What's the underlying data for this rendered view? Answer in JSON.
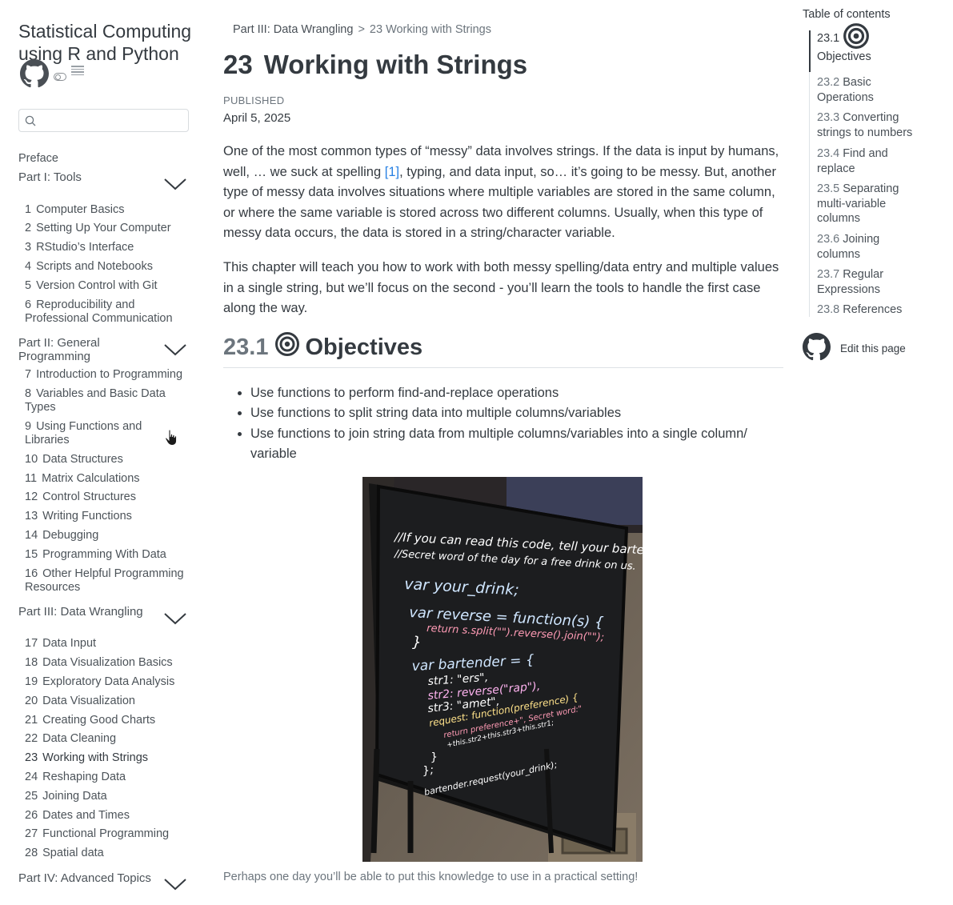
{
  "site": {
    "title": "Statistical Computing using R and Python",
    "search_placeholder": ""
  },
  "sidebar": {
    "preface": "Preface",
    "parts": [
      {
        "label": "Part I: Tools",
        "expanded": true
      },
      {
        "label": "Part II: General Programming",
        "expanded": true
      },
      {
        "label": "Part III: Data Wrangling",
        "expanded": true
      },
      {
        "label": "Part IV: Advanced Topics",
        "expanded": false
      }
    ],
    "chapters": [
      {
        "num": "1",
        "title": "Computer Basics"
      },
      {
        "num": "2",
        "title": "Setting Up Your Computer"
      },
      {
        "num": "3",
        "title": "RStudio’s Interface"
      },
      {
        "num": "4",
        "title": "Scripts and Notebooks"
      },
      {
        "num": "5",
        "title": "Version Control with Git"
      },
      {
        "num": "6",
        "title": "Reproducibility and Professional Communication"
      },
      {
        "num": "7",
        "title": "Introduction to Programming"
      },
      {
        "num": "8",
        "title": "Variables and Basic Data Types"
      },
      {
        "num": "9",
        "title": "Using Functions and Libraries"
      },
      {
        "num": "10",
        "title": "Data Structures"
      },
      {
        "num": "11",
        "title": "Matrix Calculations"
      },
      {
        "num": "12",
        "title": "Control Structures"
      },
      {
        "num": "13",
        "title": "Writing Functions"
      },
      {
        "num": "14",
        "title": "Debugging"
      },
      {
        "num": "15",
        "title": "Programming With Data"
      },
      {
        "num": "16",
        "title": "Other Helpful Programming Resources"
      },
      {
        "num": "17",
        "title": "Data Input"
      },
      {
        "num": "18",
        "title": "Data Visualization Basics"
      },
      {
        "num": "19",
        "title": "Exploratory Data Analysis"
      },
      {
        "num": "20",
        "title": "Data Visualization"
      },
      {
        "num": "21",
        "title": "Creating Good Charts"
      },
      {
        "num": "22",
        "title": "Data Cleaning"
      },
      {
        "num": "23",
        "title": "Working with Strings"
      },
      {
        "num": "24",
        "title": "Reshaping Data"
      },
      {
        "num": "25",
        "title": "Joining Data"
      },
      {
        "num": "26",
        "title": "Dates and Times"
      },
      {
        "num": "27",
        "title": "Functional Programming"
      },
      {
        "num": "28",
        "title": "Spatial data"
      }
    ]
  },
  "breadcrumb": {
    "part": "Part III: Data Wrangling",
    "separator": ">",
    "current": "23  Working with Strings"
  },
  "chapter": {
    "num": "23",
    "title": "Working with Strings",
    "published_label": "PUBLISHED",
    "published_date": "April 5, 2025"
  },
  "content": {
    "para1_a": "One of the most common types of “messy” data involves strings. If the data is input by humans, well, … we suck at spelling ",
    "para1_cite": "[1]",
    "para1_b": ", typing, and data input, so… it’s going to be messy. But, another type of messy data involves situations where multiple variables are stored in the same column, or where the same variable is stored across two different columns. Usually, when this type of messy data occurs, the data is stored in a string/character variable.",
    "para2": "This chapter will teach you how to work with both messy spelling/data entry and multiple values in a single string, but we’ll focus on the second - you’ll learn the tools to handle the first case along the way.",
    "section_num": "23.1",
    "section_title": "Objectives",
    "objectives": [
      "Use functions to perform find-and-replace operations",
      "Use functions to split string data into multiple columns/variables",
      "Use functions to join string data from multiple columns/variables into a single column/ variable"
    ],
    "figure_caption": "Perhaps one day you’ll be able to put this knowledge to use in a practical setting!"
  },
  "figure": {
    "sign_lines": [
      "//If you can read this code, tell your bartender the",
      "//Secret word of the day for a free drink on us.",
      "var   your_drink;",
      "var   reverse = function(s) {",
      "return s.split(\"\").reverse().join(\"\");",
      "}",
      "var   bartender = {",
      "str1:  \"ers\",",
      "str2:  reverse(\"rap\"),",
      "str3:  \"amet\",",
      "request: function(preference) {",
      "return preference+\", Secret word:\"",
      "+this.str2+this.str3+this.str1;",
      "}",
      "};",
      "bartender.request(your_drink);"
    ]
  },
  "toc": {
    "title": "Table of contents",
    "items": [
      {
        "num": "23.1",
        "label": "Objectives"
      },
      {
        "num": "23.2",
        "label": "Basic Operations"
      },
      {
        "num": "23.3",
        "label": "Converting strings to numbers"
      },
      {
        "num": "23.4",
        "label": "Find and replace"
      },
      {
        "num": "23.5",
        "label": "Separating multi-variable columns"
      },
      {
        "num": "23.6",
        "label": "Joining columns"
      },
      {
        "num": "23.7",
        "label": "Regular Expressions"
      },
      {
        "num": "23.8",
        "label": "References"
      }
    ],
    "edit_label": "Edit this page"
  },
  "colors": {
    "text": "#343a40",
    "muted": "#6c757d",
    "link": "#2780e3",
    "sign_background": "#1c1d1f"
  }
}
